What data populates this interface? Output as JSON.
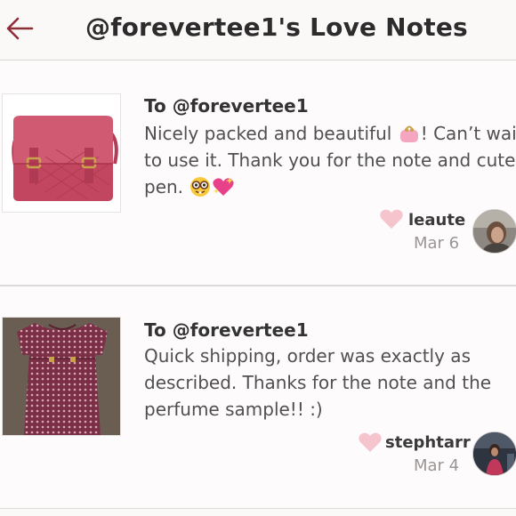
{
  "header": {
    "title": "@forevertee1's Love Notes",
    "back_icon": "back-arrow-icon"
  },
  "accent_color": "#8c2f39",
  "notes": [
    {
      "recipient": "To @forevertee1",
      "message_part1": "Nicely packed and beautiful ",
      "message_part2": "! Can’t wait to use it. Thank you for the note and cute pen. ",
      "emojis": [
        "purse-emoji",
        "nerd-face-emoji",
        "sparkling-heart-emoji"
      ],
      "username": "leaute",
      "date": "Mar 6",
      "item_image": "pink-crossbody-bag"
    },
    {
      "recipient": "To @forevertee1",
      "message": "Quick shipping, order was exactly as described. Thanks for the note and the perfume sample!! :)",
      "username": "stephtarr",
      "date": "Mar 4",
      "item_image": "patterned-shift-dress"
    }
  ]
}
